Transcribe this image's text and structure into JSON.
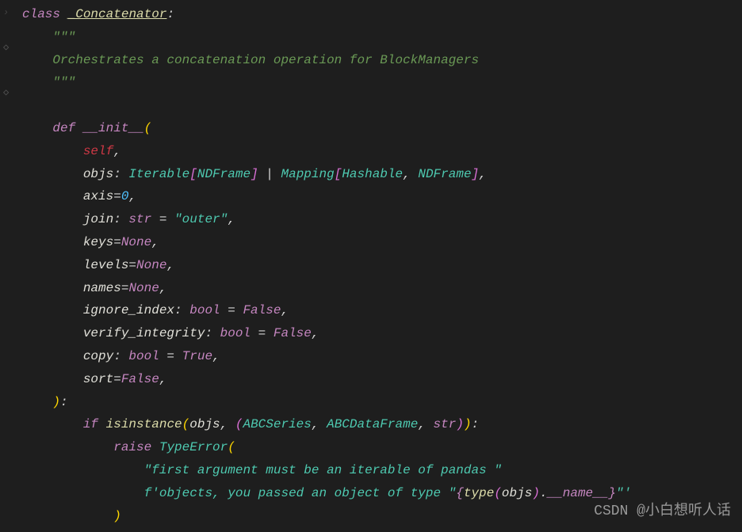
{
  "code": {
    "line1": {
      "kw_class": "class",
      "class_name": "_Concatenator",
      "colon": ":"
    },
    "line2": {
      "docstring_open": "\"\"\""
    },
    "line3": {
      "docstring_text": "Orchestrates a concatenation operation for BlockManagers"
    },
    "line4": {
      "docstring_close": "\"\"\""
    },
    "line6": {
      "kw_def": "def",
      "dunder": "__init__",
      "paren": "("
    },
    "line7": {
      "self": "self",
      "comma": ","
    },
    "line8": {
      "param": "objs",
      "type1": "Iterable",
      "type_arg1": "NDFrame",
      "pipe": "|",
      "type2": "Mapping",
      "type_arg2a": "Hashable",
      "type_arg2b": "NDFrame",
      "comma": ","
    },
    "line9": {
      "param": "axis",
      "eq": "=",
      "val": "0",
      "comma": ","
    },
    "line10": {
      "param": "join",
      "type": "str",
      "eq": " = ",
      "val": "\"outer\"",
      "colon": ": ",
      "comma": ","
    },
    "line11": {
      "param": "keys",
      "eq": "=",
      "val": "None",
      "comma": ","
    },
    "line12": {
      "param": "levels",
      "eq": "=",
      "val": "None",
      "comma": ","
    },
    "line13": {
      "param": "names",
      "eq": "=",
      "val": "None",
      "comma": ","
    },
    "line14": {
      "param": "ignore_index",
      "colon": ": ",
      "type": "bool",
      "eq": " = ",
      "val": "False",
      "comma": ","
    },
    "line15": {
      "param": "verify_integrity",
      "colon": ": ",
      "type": "bool",
      "eq": " = ",
      "val": "False",
      "comma": ","
    },
    "line16": {
      "param": "copy",
      "colon": ": ",
      "type": "bool",
      "eq": " = ",
      "val": "True",
      "comma": ","
    },
    "line17": {
      "param": "sort",
      "eq": "=",
      "val": "False",
      "comma": ","
    },
    "line18": {
      "close_paren": ")",
      "colon": ":"
    },
    "line19": {
      "kw_if": "if",
      "builtin": "isinstance",
      "arg1": "objs",
      "t1": "ABCSeries",
      "t2": "ABCDataFrame",
      "t3": "str",
      "colon": ":"
    },
    "line20": {
      "kw_raise": "raise",
      "exc": "TypeError",
      "paren": "("
    },
    "line21": {
      "str": "\"first argument must be an iterable of pandas \""
    },
    "line22": {
      "fprefix": "f",
      "str1": "'objects, you passed an object of type \"",
      "brace_open": "{",
      "builtin": "type",
      "arg": "objs",
      "dot": ".",
      "attr": "__name__",
      "brace_close": "}",
      "str2": "\"'"
    },
    "line23": {
      "close_paren": ")"
    }
  },
  "watermark": "CSDN @小白想听人话"
}
